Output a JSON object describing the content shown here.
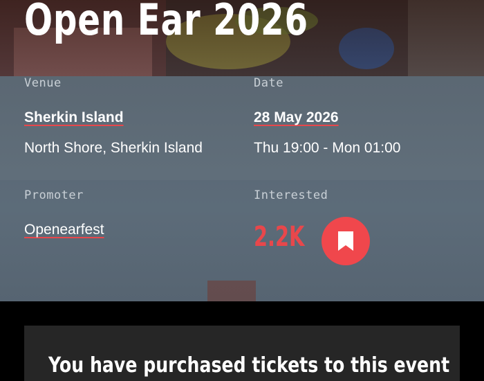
{
  "event": {
    "title": "Open Ear 2026"
  },
  "details": {
    "venue": {
      "label": "Venue",
      "name": "Sherkin Island",
      "address": "North Shore, Sherkin Island"
    },
    "date": {
      "label": "Date",
      "date": "28 May 2026",
      "time": "Thu 19:00 - Mon 01:00"
    },
    "promoter": {
      "label": "Promoter",
      "name": "Openearfest"
    },
    "interested": {
      "label": "Interested",
      "count": "2.2K",
      "bookmark_icon": "bookmark-icon"
    }
  },
  "ticket_notice": {
    "text": "You have purchased tickets to this event"
  },
  "colors": {
    "accent": "#f0474c",
    "background": "#000000",
    "card": "#262626"
  }
}
